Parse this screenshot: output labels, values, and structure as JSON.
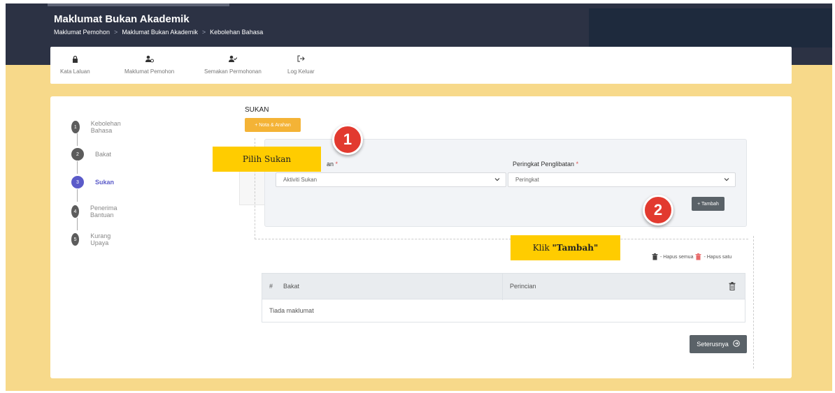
{
  "header": {
    "title": "Maklumat Bukan Akademik",
    "breadcrumb": [
      "Maklumat Pemohon",
      "Maklumat Bukan Akademik",
      "Kebolehan Bahasa"
    ],
    "breadcrumb_separator": ">"
  },
  "navbar": {
    "items": [
      {
        "label": "Kata Laluan",
        "icon": "lock-icon"
      },
      {
        "label": "Maklumat Pemohon",
        "icon": "user-group-icon"
      },
      {
        "label": "Semakan Permohonan",
        "icon": "user-check-icon"
      },
      {
        "label": "Log Keluar",
        "icon": "sign-out-icon"
      }
    ]
  },
  "steps": [
    {
      "num": "1",
      "label": "Kebolehan Bahasa"
    },
    {
      "num": "2",
      "label": "Bakat"
    },
    {
      "num": "3",
      "label": "Sukan"
    },
    {
      "num": "4",
      "label": "Penerima Bantuan"
    },
    {
      "num": "5",
      "label": "Kurang Upaya"
    }
  ],
  "active_step_index": 2,
  "section": {
    "title": "SUKAN",
    "nota_button": "+ Nota & Arahan"
  },
  "form": {
    "field1_label_visible": "an",
    "field1_placeholder": "Aktiviti Sukan",
    "field2_label": "Peringkat Penglibatan",
    "field2_placeholder": "Peringkat",
    "required_mark": "*",
    "tambah_button": "+ Tambah"
  },
  "hapus": {
    "semua": "- Hapus semua",
    "satu": "- Hapus satu"
  },
  "table": {
    "col_index": "#",
    "col_bakat": "Bakat",
    "col_perincian": "Perincian",
    "empty_text": "Tiada maklumat"
  },
  "next_button": "Seterusnya",
  "annotations": {
    "callout1": "Pilih Sukan",
    "callout2_prefix": "Klik ",
    "callout2_bold": "\"Tambah\"",
    "badge1": "1",
    "badge2": "2"
  },
  "colors": {
    "header_bg": "#2c3244",
    "page_bg": "#f7d98a",
    "accent_orange": "#f4b336",
    "active_step": "#5b5bc9",
    "callout": "#ffcc00",
    "badge": "#e23a2f"
  }
}
